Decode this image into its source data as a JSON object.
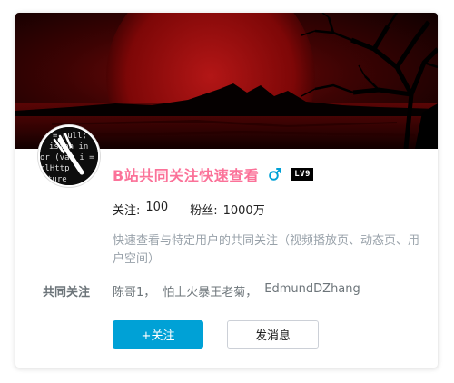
{
  "card": {
    "username": "B站共同关注快速查看",
    "level": "LV9",
    "gender_icon": "male-icon",
    "colors": {
      "username": "#fb7299",
      "gender": "#00a1d6",
      "follow_button": "#00a1d6"
    },
    "stats": {
      "following_label": "关注:",
      "following_value": "100",
      "fans_label": "粉丝:",
      "fans_value": "1000万"
    },
    "description": "快速查看与特定用户的共同关注（视频播放页、动态页、用户空间）",
    "common_follow": {
      "label": "共同关注",
      "users": [
        "陈哥1，",
        "怕上火暴王老菊，",
        "EdmundDZhang"
      ]
    },
    "buttons": {
      "follow": "+关注",
      "message": "发消息"
    },
    "avatar_code_text": [
      "= null;",
      "ision in",
      "or (var i = 0",
      "mlHttp",
      "ture"
    ]
  }
}
